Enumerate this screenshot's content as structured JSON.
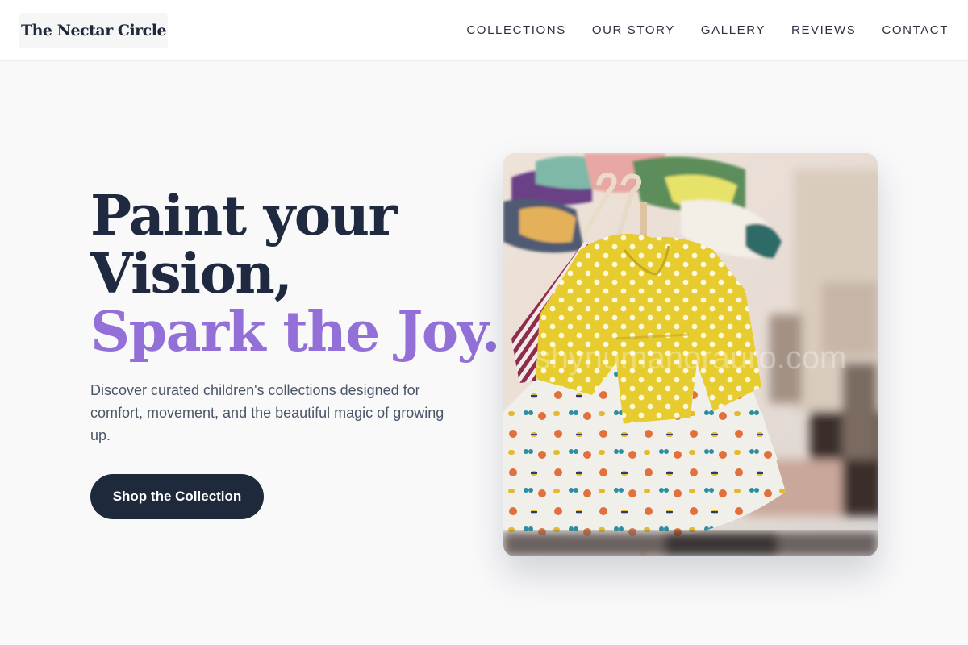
{
  "brand": {
    "name": "The Nectar Circle"
  },
  "nav": {
    "items": [
      {
        "label": "COLLECTIONS"
      },
      {
        "label": "OUR STORY"
      },
      {
        "label": "GALLERY"
      },
      {
        "label": "REVIEWS"
      },
      {
        "label": "CONTACT"
      }
    ]
  },
  "hero": {
    "headline_line1": "Paint your",
    "headline_line2": "Vision,",
    "headline_accent": "Spark the Joy.",
    "description": "Discover curated children's collections designed for comfort, movement, and the beautiful magic of growing up.",
    "cta_label": "Shop the Collection",
    "image_watermark": "shynumanorauro.com"
  },
  "colors": {
    "primary": "#1e293b",
    "accent": "#9370d8",
    "background": "#f9f9fa",
    "body_text": "#4a5568"
  }
}
